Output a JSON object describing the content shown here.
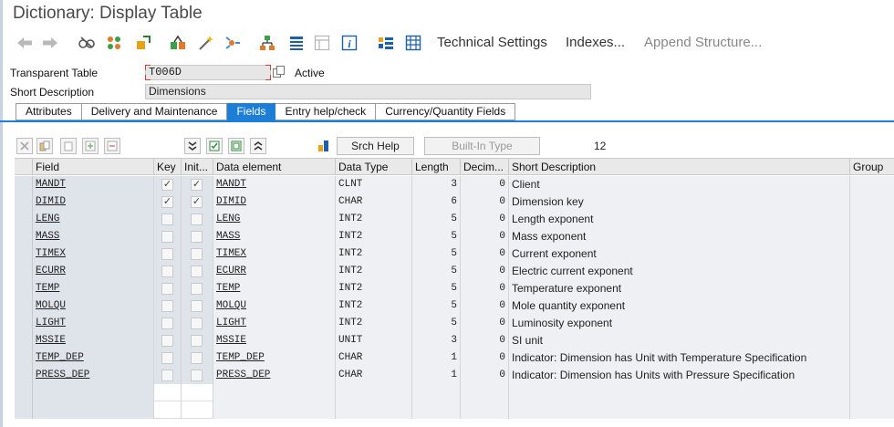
{
  "window": {
    "title": "Dictionary: Display Table"
  },
  "toolbar": {
    "icons": [
      "back-icon",
      "forward-icon",
      "display-change-icon",
      "other-object-icon",
      "activate-icon",
      "where-used-icon",
      "magic-wand-icon",
      "navigate-icon",
      "hierarchy-icon",
      "list-icon",
      "layout-icon",
      "info-icon",
      "structure-icon",
      "grid-icon"
    ],
    "technical_settings": "Technical Settings",
    "indexes": "Indexes...",
    "append_structure": "Append Structure..."
  },
  "header": {
    "table_type_label": "Transparent Table",
    "table_name": "T006D",
    "status": "Active",
    "short_desc_label": "Short Description",
    "short_desc_value": "Dimensions"
  },
  "tabs": [
    {
      "label": "Attributes",
      "active": false
    },
    {
      "label": "Delivery and Maintenance",
      "active": false
    },
    {
      "label": "Fields",
      "active": true
    },
    {
      "label": "Entry help/check",
      "active": false
    },
    {
      "label": "Currency/Quantity Fields",
      "active": false
    }
  ],
  "fields_toolbar": {
    "srch_help": "Srch Help",
    "built_in_type": "Built-In Type",
    "count": "12"
  },
  "grid": {
    "columns": [
      "Field",
      "Key",
      "Init...",
      "Data element",
      "Data Type",
      "Length",
      "Decim...",
      "Short Description",
      "Group"
    ],
    "rows": [
      {
        "field": "MANDT",
        "key": true,
        "init": true,
        "data_element": "MANDT",
        "data_type": "CLNT",
        "length": "3",
        "decimals": "0",
        "description": "Client"
      },
      {
        "field": "DIMID",
        "key": true,
        "init": true,
        "data_element": "DIMID",
        "data_type": "CHAR",
        "length": "6",
        "decimals": "0",
        "description": "Dimension key"
      },
      {
        "field": "LENG",
        "key": false,
        "init": false,
        "data_element": "LENG",
        "data_type": "INT2",
        "length": "5",
        "decimals": "0",
        "description": "Length exponent"
      },
      {
        "field": "MASS",
        "key": false,
        "init": false,
        "data_element": "MASS",
        "data_type": "INT2",
        "length": "5",
        "decimals": "0",
        "description": "Mass exponent"
      },
      {
        "field": "TIMEX",
        "key": false,
        "init": false,
        "data_element": "TIMEX",
        "data_type": "INT2",
        "length": "5",
        "decimals": "0",
        "description": "Current exponent"
      },
      {
        "field": "ECURR",
        "key": false,
        "init": false,
        "data_element": "ECURR",
        "data_type": "INT2",
        "length": "5",
        "decimals": "0",
        "description": "Electric current exponent"
      },
      {
        "field": "TEMP",
        "key": false,
        "init": false,
        "data_element": "TEMP",
        "data_type": "INT2",
        "length": "5",
        "decimals": "0",
        "description": "Temperature exponent"
      },
      {
        "field": "MOLQU",
        "key": false,
        "init": false,
        "data_element": "MOLQU",
        "data_type": "INT2",
        "length": "5",
        "decimals": "0",
        "description": "Mole quantity exponent"
      },
      {
        "field": "LIGHT",
        "key": false,
        "init": false,
        "data_element": "LIGHT",
        "data_type": "INT2",
        "length": "5",
        "decimals": "0",
        "description": "Luminosity exponent"
      },
      {
        "field": "MSSIE",
        "key": false,
        "init": false,
        "data_element": "MSSIE",
        "data_type": "UNIT",
        "length": "3",
        "decimals": "0",
        "description": "SI unit"
      },
      {
        "field": "TEMP_DEP",
        "key": false,
        "init": false,
        "data_element": "TEMP_DEP",
        "data_type": "CHAR",
        "length": "1",
        "decimals": "0",
        "description": "Indicator: Dimension has Unit with Temperature Specification"
      },
      {
        "field": "PRESS_DEP",
        "key": false,
        "init": false,
        "data_element": "PRESS_DEP",
        "data_type": "CHAR",
        "length": "1",
        "decimals": "0",
        "description": "Indicator: Dimension has Units with Pressure Specification"
      }
    ]
  },
  "colors": {
    "accent": "#1d7ed6",
    "row_selection": "#dfe4ea"
  }
}
